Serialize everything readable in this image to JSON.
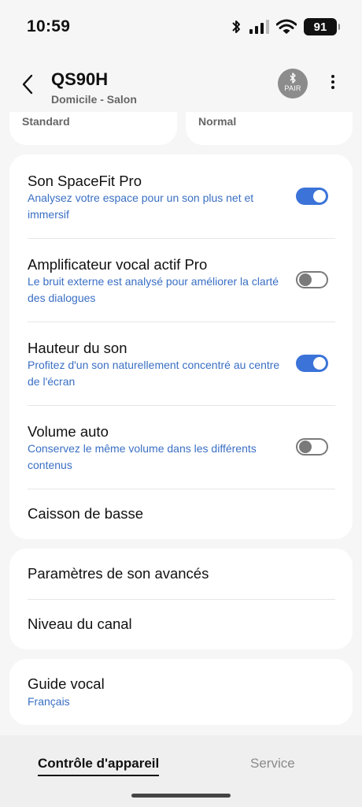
{
  "status_bar": {
    "time": "10:59",
    "battery": "91",
    "icons": [
      "bluetooth-icon",
      "signal-icon",
      "wifi-icon",
      "battery-icon"
    ]
  },
  "header": {
    "title": "QS90H",
    "subtitle": "Domicile - Salon",
    "pair_label": "PAIR"
  },
  "top_cards": {
    "left": "Standard",
    "right": "Normal"
  },
  "sound_settings": [
    {
      "title": "Son SpaceFit Pro",
      "description": "Analysez votre espace pour un son plus net et immersif",
      "enabled": true
    },
    {
      "title": "Amplificateur vocal actif Pro",
      "description": "Le bruit externe est analysé pour améliorer la clarté des dialogues",
      "enabled": false
    },
    {
      "title": "Hauteur du son",
      "description": "Profitez d'un son naturellement concentré au centre de l'écran",
      "enabled": true
    },
    {
      "title": "Volume auto",
      "description": "Conservez le même volume dans les différents contenus",
      "enabled": false
    },
    {
      "title": "Caisson de basse"
    }
  ],
  "advanced": {
    "advanced_sound": "Paramètres de son avancés",
    "channel_level": "Niveau du canal"
  },
  "voice_guide": {
    "title": "Guide vocal",
    "value": "Français"
  },
  "bottom_nav": {
    "device_control": "Contrôle d'appareil",
    "service": "Service"
  },
  "colors": {
    "accent": "#3b73d8",
    "description_text": "#3a6fc4",
    "toggle_off": "#7a7a7a"
  }
}
